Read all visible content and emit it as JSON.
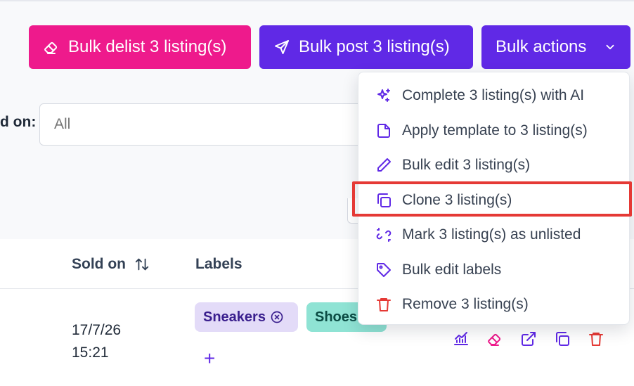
{
  "toolbar": {
    "delist_label": "Bulk delist 3 listing(s)",
    "post_label": "Bulk post 3 listing(s)",
    "actions_label": "Bulk actions"
  },
  "filter": {
    "label": "d on:",
    "placeholder": "All"
  },
  "table": {
    "columns": {
      "sold_on": "Sold on",
      "labels": "Labels"
    },
    "row": {
      "sold_date": "17/7/26",
      "sold_time": "15:21",
      "tags": [
        "Sneakers",
        "Shoes"
      ],
      "add_label_symbol": "+"
    }
  },
  "menu": {
    "items": [
      {
        "label": "Complete 3 listing(s) with AI",
        "icon": "sparkles-icon"
      },
      {
        "label": "Apply template to 3 listing(s)",
        "icon": "document-icon"
      },
      {
        "label": "Bulk edit 3 listing(s)",
        "icon": "pencil-icon"
      },
      {
        "label": "Clone 3 listing(s)",
        "icon": "copy-icon"
      },
      {
        "label": "Mark 3 listing(s) as unlisted",
        "icon": "broken-link-icon"
      },
      {
        "label": "Bulk edit labels",
        "icon": "tag-icon"
      },
      {
        "label": "Remove 3 listing(s)",
        "icon": "trash-icon"
      }
    ],
    "highlighted_item": "Clone 3 listing(s)"
  },
  "colors": {
    "delist": "#ee1a8c",
    "primary": "#6029e6",
    "highlight": "#e53935",
    "danger": "#e53935"
  }
}
